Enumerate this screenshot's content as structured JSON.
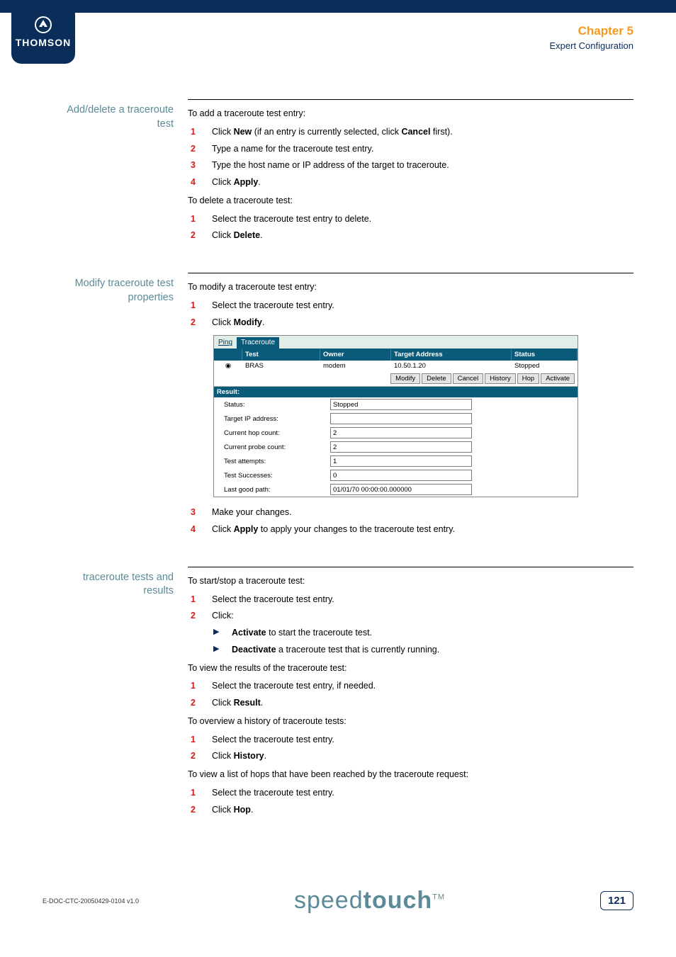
{
  "header": {
    "brand": "THOMSON",
    "chapter": "Chapter 5",
    "section": "Expert Configuration"
  },
  "s1": {
    "title": "Add/delete a traceroute test",
    "intro": "To add a traceroute test entry:",
    "i1a": "Click ",
    "i1b": "New",
    "i1c": " (if an entry is currently selected, click ",
    "i1d": "Cancel",
    "i1e": " first).",
    "i2": "Type a name for the traceroute test entry.",
    "i3": "Type the host name or IP address of the target to traceroute.",
    "i4a": "Click ",
    "i4b": "Apply",
    "i4c": ".",
    "del_intro": "To delete a traceroute test:",
    "d1": "Select the traceroute test entry to delete.",
    "d2a": "Click ",
    "d2b": "Delete",
    "d2c": "."
  },
  "s2": {
    "title": "Modify traceroute test properties",
    "intro": "To modify a traceroute test entry:",
    "i1": "Select the traceroute test entry.",
    "i2a": "Click ",
    "i2b": "Modify",
    "i2c": ".",
    "i3": "Make your changes.",
    "i4a": "Click ",
    "i4b": "Apply",
    "i4c": " to apply your changes to the traceroute test entry."
  },
  "ui": {
    "tab_ping": "Ping",
    "tab_traceroute": "Traceroute",
    "h_test": "Test",
    "h_owner": "Owner",
    "h_target": "Target Address",
    "h_status": "Status",
    "r_test": "BRAS",
    "r_owner": "modem",
    "r_target": "10.50.1.20",
    "r_status": "Stopped",
    "btn_modify": "Modify",
    "btn_delete": "Delete",
    "btn_cancel": "Cancel",
    "btn_history": "History",
    "btn_hop": "Hop",
    "btn_activate": "Activate",
    "result": "Result:",
    "f_status_l": "Status:",
    "f_status_v": "Stopped",
    "f_ip_l": "Target IP address:",
    "f_ip_v": "",
    "f_hop_l": "Current hop count:",
    "f_hop_v": "2",
    "f_probe_l": "Current probe count:",
    "f_probe_v": "2",
    "f_att_l": "Test attempts:",
    "f_att_v": "1",
    "f_succ_l": "Test Successes:",
    "f_succ_v": "0",
    "f_path_l": "Last good path:",
    "f_path_v": "01/01/70 00:00:00.000000"
  },
  "s3": {
    "title": "traceroute tests and results",
    "p1": "To start/stop a traceroute test:",
    "a1": "Select the traceroute test entry.",
    "a2": "Click:",
    "sub1a": "Activate",
    "sub1b": " to start the traceroute test.",
    "sub2a": "Deactivate",
    "sub2b": " a traceroute test that is currently running.",
    "p2": "To view the results of the traceroute test:",
    "b1": "Select the traceroute test entry, if needed.",
    "b2a": "Click ",
    "b2b": "Result",
    "b2c": ".",
    "p3": "To overview a history of traceroute tests:",
    "c1": "Select the traceroute test entry.",
    "c2a": "Click ",
    "c2b": "History",
    "c2c": ".",
    "p4": "To view a list of hops that have been reached by the traceroute request:",
    "d1": "Select the traceroute test entry.",
    "d2a": "Click ",
    "d2b": "Hop",
    "d2c": "."
  },
  "footer": {
    "docref": "E-DOC-CTC-20050429-0104 v1.0",
    "brand_thin": "speed",
    "brand_bold": "touch",
    "tm": "TM",
    "page": "121"
  }
}
